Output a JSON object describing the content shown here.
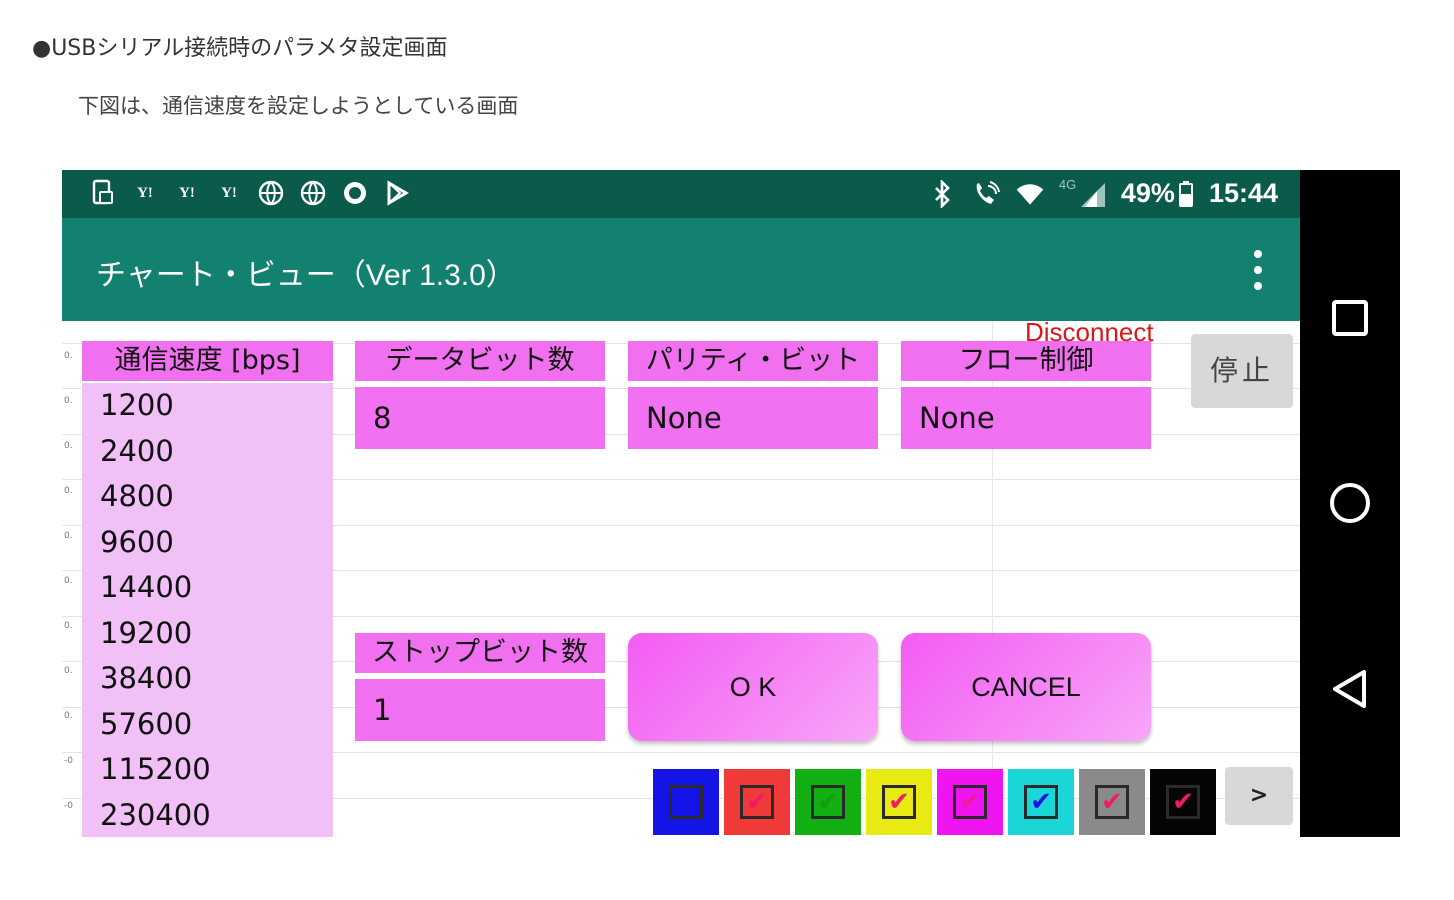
{
  "document": {
    "heading": "●USBシリアル接続時のパラメタ設定画面",
    "subheading": "下図は、通信速度を設定しようとしている画面"
  },
  "status_bar": {
    "left_icons": [
      "file-phone-icon",
      "yahoo-icon",
      "yahoo-icon",
      "yahoo-icon",
      "globe-icon",
      "globe-icon",
      "circle-icon",
      "play-store-icon"
    ],
    "yahoo_text": "Y!",
    "network_label": "4G",
    "battery": "49%",
    "time": "15:44"
  },
  "app_bar": {
    "title": "チャート・ビュー（Ver 1.3.0）"
  },
  "axis_labels": [
    "0.",
    "0.",
    "0.",
    "0.",
    "0.",
    "0.",
    "0.",
    "0.",
    "0.",
    "-0",
    "-0",
    "-0"
  ],
  "params": {
    "speed": {
      "label": "通信速度 [bps]",
      "options": [
        "1200",
        "2400",
        "4800",
        "9600",
        "14400",
        "19200",
        "38400",
        "57600",
        "115200",
        "230400"
      ]
    },
    "data_bits": {
      "label": "データビット数",
      "value": "8"
    },
    "parity": {
      "label": "パリティ・ビット",
      "value": "None"
    },
    "flow": {
      "label": "フロー制御",
      "value": "None"
    },
    "stop_bits": {
      "label": "ストップビット数",
      "value": "1"
    }
  },
  "disconnect_label": "Disconnect",
  "stop_button": "停止",
  "ok_button": "O K",
  "cancel_button": "CANCEL",
  "channel_colors": [
    "#1414e6",
    "#f03a3a",
    "#12b012",
    "#e9e914",
    "#f014f0",
    "#1ad6d6",
    "#8a8a8a",
    "#050505"
  ],
  "check_colors": [
    "#1414e6",
    "#f01a6a",
    "#0e9e0e",
    "#f01a6a",
    "#f01a9a",
    "#1414e6",
    "#f01a6a",
    "#f01a6a"
  ],
  "check_glyph": "✔",
  "next_button": ">",
  "nav_icons": [
    "recents-icon",
    "home-icon",
    "back-icon"
  ]
}
